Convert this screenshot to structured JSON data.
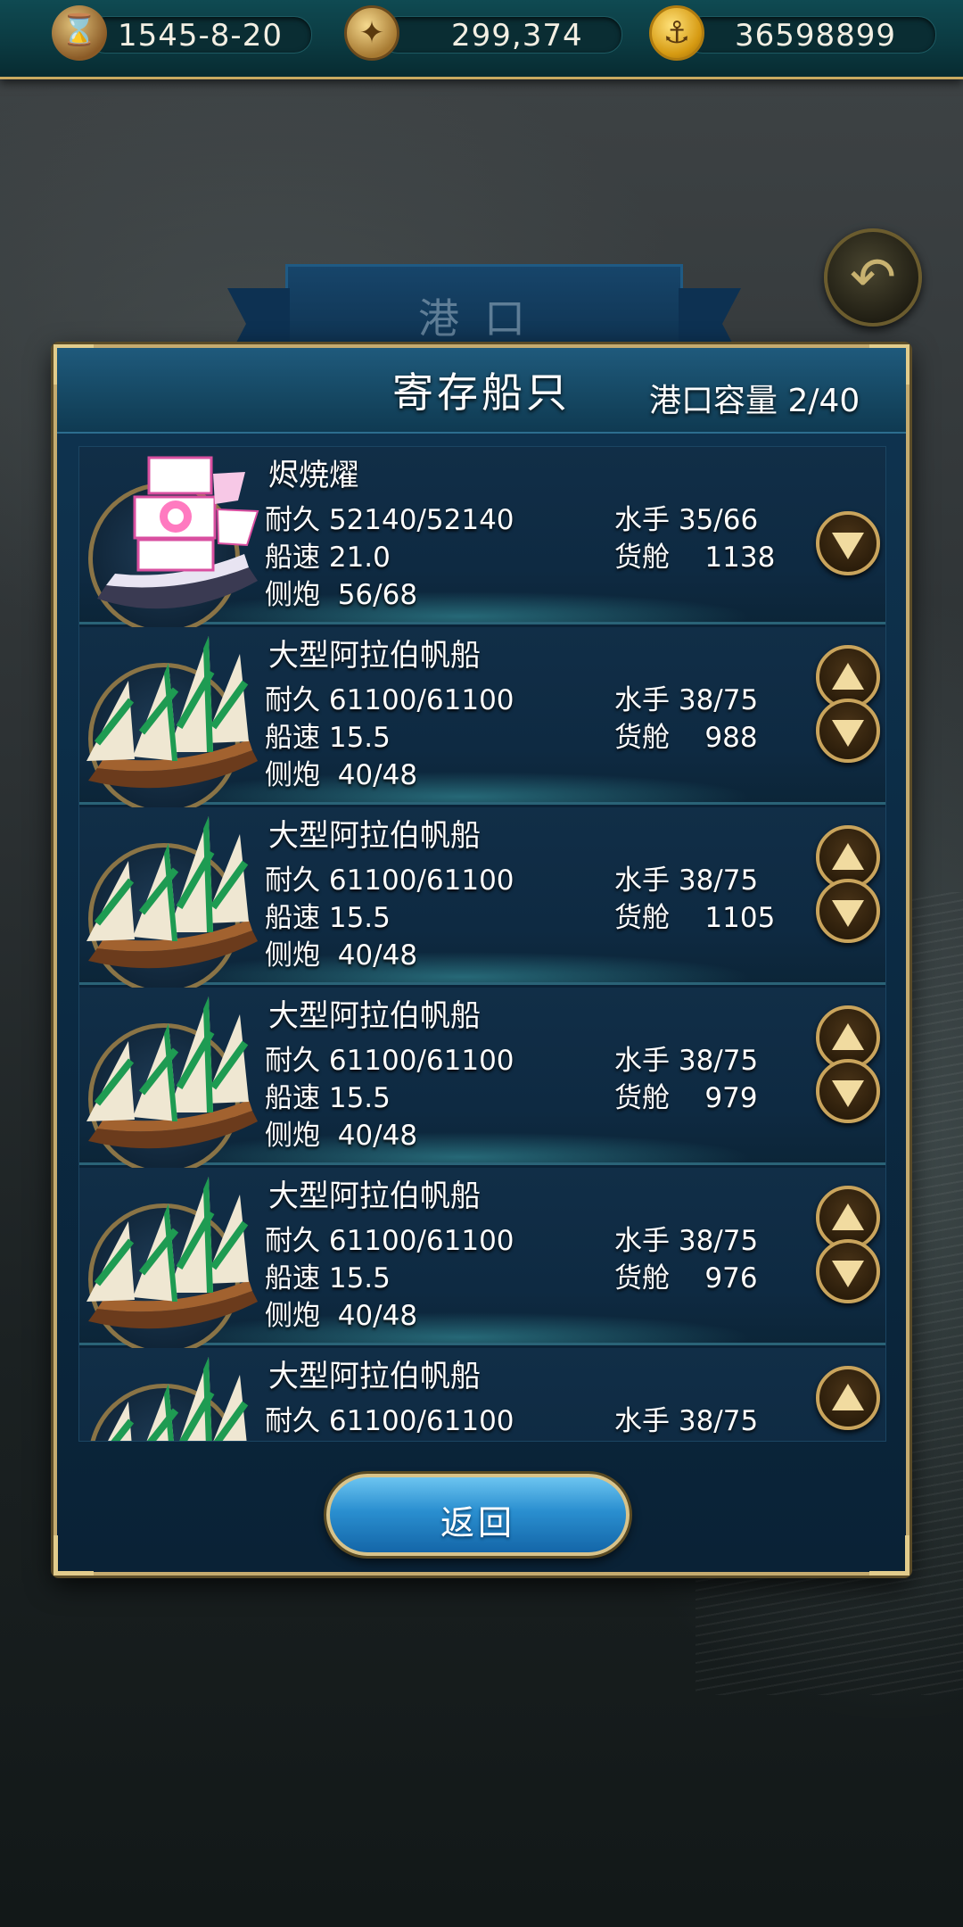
{
  "resources": {
    "date": "1545-8-20",
    "exploration": "299,374",
    "gold": "36598899",
    "icons": [
      "hourglass-icon",
      "compass-icon",
      "gold-coin-icon"
    ]
  },
  "port": {
    "title": "港口"
  },
  "dialog": {
    "title": "寄存船只",
    "capacity": "港口容量 2/40",
    "return_label": "返回"
  },
  "ships": [
    {
      "name": "烬焼燿",
      "durability": "耐久 52140/52140",
      "speed": "船速 21.0",
      "cannons": "侧炮  56/68",
      "crew": "水手 35/66",
      "cargo": "货舱    1138",
      "up": false,
      "down": true,
      "style": "pink"
    },
    {
      "name": "大型阿拉伯帆船",
      "durability": "耐久 61100/61100",
      "speed": "船速 15.5",
      "cannons": "侧炮  40/48",
      "crew": "水手 38/75",
      "cargo": "货舱    988",
      "up": true,
      "down": true,
      "style": "green"
    },
    {
      "name": "大型阿拉伯帆船",
      "durability": "耐久 61100/61100",
      "speed": "船速 15.5",
      "cannons": "侧炮  40/48",
      "crew": "水手 38/75",
      "cargo": "货舱    1105",
      "up": true,
      "down": true,
      "style": "green"
    },
    {
      "name": "大型阿拉伯帆船",
      "durability": "耐久 61100/61100",
      "speed": "船速 15.5",
      "cannons": "侧炮  40/48",
      "crew": "水手 38/75",
      "cargo": "货舱    979",
      "up": true,
      "down": true,
      "style": "green"
    },
    {
      "name": "大型阿拉伯帆船",
      "durability": "耐久 61100/61100",
      "speed": "船速 15.5",
      "cannons": "侧炮  40/48",
      "crew": "水手 38/75",
      "cargo": "货舱    976",
      "up": true,
      "down": true,
      "style": "green"
    },
    {
      "name": "大型阿拉伯帆船",
      "durability": "耐久 61100/61100",
      "speed": "",
      "cannons": "",
      "crew": "水手 38/75",
      "cargo": "",
      "up": true,
      "down": false,
      "style": "green"
    }
  ]
}
